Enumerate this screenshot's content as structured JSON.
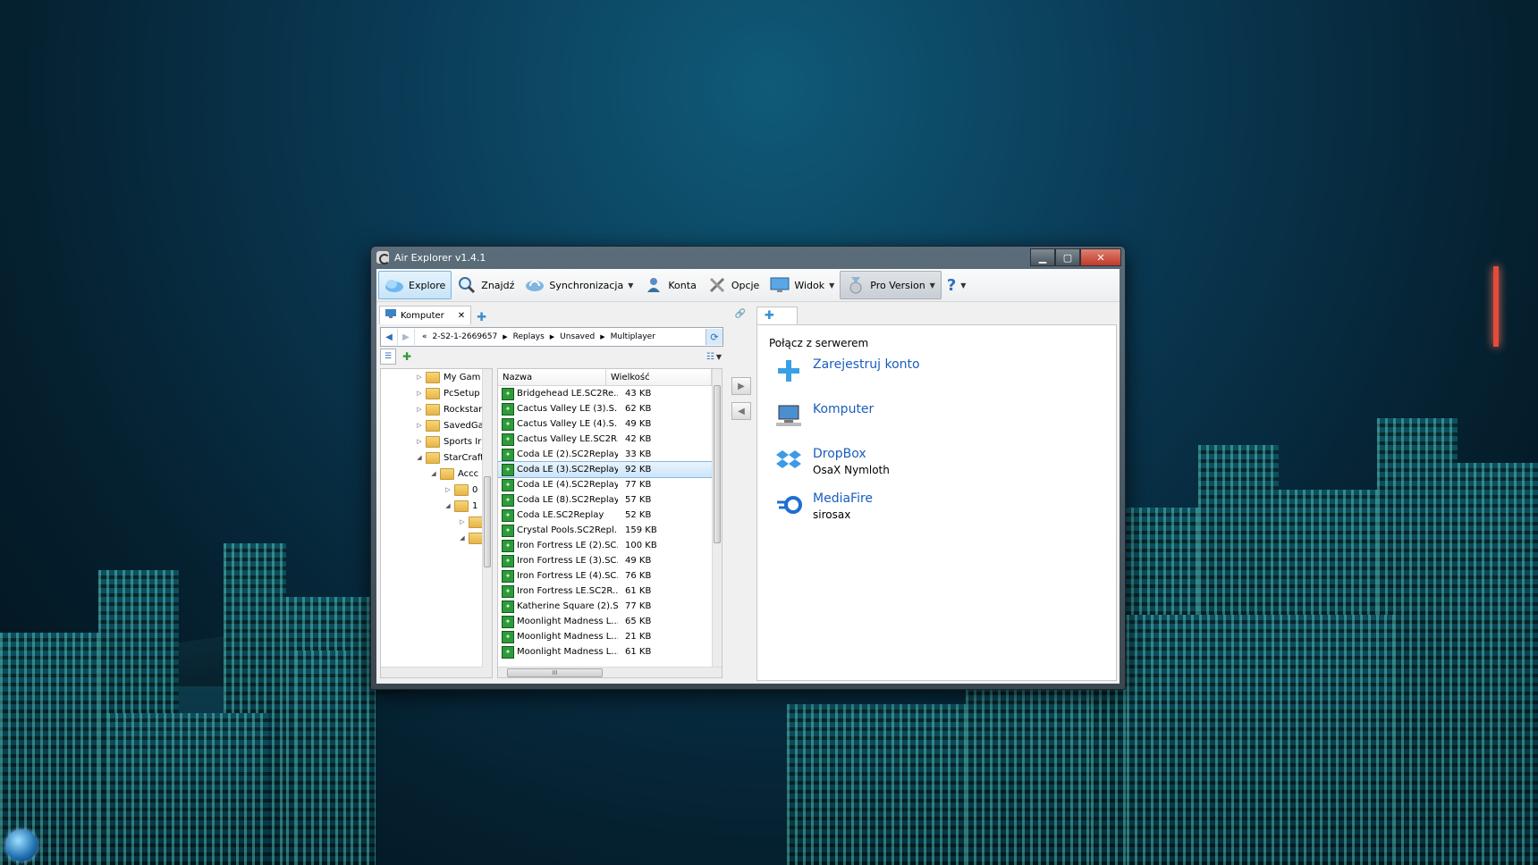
{
  "window": {
    "title": "Air Explorer v1.4.1"
  },
  "toolbar": {
    "explore": "Explore",
    "find": "Znajdź",
    "sync": "Synchronizacja",
    "accounts": "Konta",
    "options": "Opcje",
    "view": "Widok",
    "pro": "Pro Version",
    "help": "?"
  },
  "left": {
    "tab": "Komputer",
    "breadcrumb": [
      "2-S2-1-2669657",
      "Replays",
      "Unsaved",
      "Multiplayer"
    ],
    "tree": [
      {
        "label": "My Gam",
        "indent": 0,
        "exp": "▷"
      },
      {
        "label": "PcSetup",
        "indent": 0,
        "exp": "▷"
      },
      {
        "label": "Rockstar",
        "indent": 0,
        "exp": "▷"
      },
      {
        "label": "SavedGa",
        "indent": 0,
        "exp": "▷"
      },
      {
        "label": "Sports Ir",
        "indent": 0,
        "exp": "▷"
      },
      {
        "label": "StarCraft",
        "indent": 0,
        "exp": "◢"
      },
      {
        "label": "Accc",
        "indent": 1,
        "exp": "◢"
      },
      {
        "label": "0",
        "indent": 2,
        "exp": "▷"
      },
      {
        "label": "1",
        "indent": 2,
        "exp": "◢"
      },
      {
        "label": "",
        "indent": 3,
        "exp": "▷"
      },
      {
        "label": "",
        "indent": 3,
        "exp": "◢"
      }
    ],
    "columns": {
      "name": "Nazwa",
      "size": "Wielkość"
    },
    "files": [
      {
        "name": "Bridgehead LE.SC2Re...",
        "size": "43 KB"
      },
      {
        "name": "Cactus Valley LE (3).S...",
        "size": "62 KB"
      },
      {
        "name": "Cactus Valley LE (4).S...",
        "size": "49 KB"
      },
      {
        "name": "Cactus Valley LE.SC2R...",
        "size": "42 KB"
      },
      {
        "name": "Coda LE (2).SC2Replay",
        "size": "33 KB"
      },
      {
        "name": "Coda LE (3).SC2Replay",
        "size": "92 KB"
      },
      {
        "name": "Coda LE (4).SC2Replay",
        "size": "77 KB"
      },
      {
        "name": "Coda LE (8).SC2Replay",
        "size": "57 KB"
      },
      {
        "name": "Coda LE.SC2Replay",
        "size": "52 KB"
      },
      {
        "name": "Crystal Pools.SC2Repl...",
        "size": "159 KB"
      },
      {
        "name": "Iron Fortress LE (2).SC...",
        "size": "100 KB"
      },
      {
        "name": "Iron Fortress LE (3).SC...",
        "size": "49 KB"
      },
      {
        "name": "Iron Fortress LE (4).SC...",
        "size": "76 KB"
      },
      {
        "name": "Iron Fortress LE.SC2R...",
        "size": "61 KB"
      },
      {
        "name": "Katherine Square (2).S...",
        "size": "77 KB"
      },
      {
        "name": "Moonlight Madness L...",
        "size": "65 KB"
      },
      {
        "name": "Moonlight Madness L...",
        "size": "21 KB"
      },
      {
        "name": "Moonlight Madness L...",
        "size": "61 KB"
      }
    ],
    "selected_index": 5,
    "hscroll_grip": "III"
  },
  "right": {
    "title": "Połącz z serwerem",
    "services": [
      {
        "name": "Zarejestruj konto",
        "sub": ""
      },
      {
        "name": "Komputer",
        "sub": ""
      },
      {
        "name": "DropBox",
        "sub": "OsaX Nymloth"
      },
      {
        "name": "MediaFire",
        "sub": "sirosax"
      }
    ]
  },
  "colors": {
    "link": "#1a5dbf",
    "selection": "#cce5fa",
    "sc2_icon": "#2e9a3a"
  }
}
